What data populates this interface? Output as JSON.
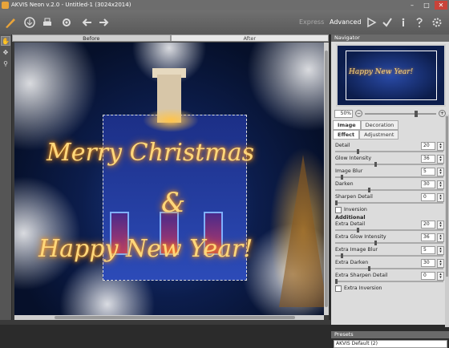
{
  "window": {
    "title": "AKVIS Neon v.2.0 - Untitled-1 (3024x2014)",
    "minimize": "–",
    "maximize": "□",
    "close": "✕"
  },
  "toolbar": {
    "modes": {
      "express": "Express",
      "advanced": "Advanced"
    },
    "icons": [
      "brush-icon",
      "save-icon",
      "print-icon",
      "settings-icon",
      "undo-icon",
      "redo-icon",
      "run-icon",
      "apply-icon",
      "info-icon",
      "help-icon",
      "preferences-icon"
    ]
  },
  "canvas": {
    "tabs": {
      "before": "Before",
      "after": "After"
    },
    "image_text": {
      "line1": "Merry Christmas",
      "line2": "&",
      "line3": "Happy New Year!"
    }
  },
  "navigator": {
    "header": "Navigator",
    "zoom": "50%",
    "zoom_out": "−",
    "zoom_in": "+",
    "thumb_text": "Happy New Year!"
  },
  "panel": {
    "tabs": {
      "image": "Image",
      "decoration": "Decoration"
    },
    "subtabs": {
      "effect": "Effect",
      "adjustment": "Adjustment"
    },
    "params": [
      {
        "label": "Detail",
        "value": "20",
        "level": 0.2
      },
      {
        "label": "Glow Intensity",
        "value": "36",
        "level": 0.36
      },
      {
        "label": "Image Blur",
        "value": "5",
        "level": 0.05
      },
      {
        "label": "Darken",
        "value": "30",
        "level": 0.3
      },
      {
        "label": "Sharpen Detail",
        "value": "0",
        "level": 0.0
      }
    ],
    "inversion": "Inversion",
    "additional": "Additional",
    "extra_params": [
      {
        "label": "Extra Detail",
        "value": "20",
        "level": 0.2
      },
      {
        "label": "Extra Glow Intensity",
        "value": "36",
        "level": 0.36
      },
      {
        "label": "Extra Image Blur",
        "value": "5",
        "level": 0.05
      },
      {
        "label": "Extra Darken",
        "value": "30",
        "level": 0.3
      },
      {
        "label": "Extra Sharpen Detail",
        "value": "0",
        "level": 0.0
      }
    ],
    "extra_inversion": "Extra Inversion"
  },
  "presets": {
    "header": "Presets",
    "selected": "AKVIS Default (2)"
  }
}
